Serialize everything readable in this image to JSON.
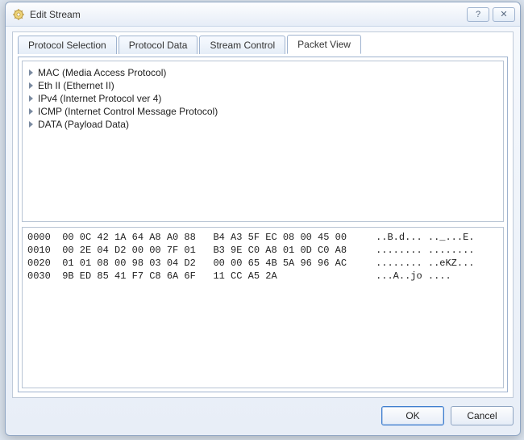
{
  "window": {
    "title": "Edit Stream",
    "icon": "gear-icon",
    "help_glyph": "?",
    "close_glyph": "✕"
  },
  "tabs": [
    {
      "label": "Protocol Selection",
      "active": false
    },
    {
      "label": "Protocol Data",
      "active": false
    },
    {
      "label": "Stream Control",
      "active": false
    },
    {
      "label": "Packet View",
      "active": true
    }
  ],
  "tree": [
    {
      "label": "MAC (Media Access Protocol)"
    },
    {
      "label": "Eth II (Ethernet II)"
    },
    {
      "label": "IPv4 (Internet Protocol ver 4)"
    },
    {
      "label": "ICMP (Internet Control Message Protocol)"
    },
    {
      "label": "DATA (Payload Data)"
    }
  ],
  "hex": {
    "rows": [
      {
        "offset": "0000",
        "bytes1": "00 0C 42 1A 64 A8 A0 88",
        "bytes2": "B4 A3 5F EC 08 00 45 00",
        "ascii": "..B.d... .._...E."
      },
      {
        "offset": "0010",
        "bytes1": "00 2E 04 D2 00 00 7F 01",
        "bytes2": "B3 9E C0 A8 01 0D C0 A8",
        "ascii": "........ ........"
      },
      {
        "offset": "0020",
        "bytes1": "01 01 08 00 98 03 04 D2",
        "bytes2": "00 00 65 4B 5A 96 96 AC",
        "ascii": "........ ..eKZ..."
      },
      {
        "offset": "0030",
        "bytes1": "9B ED 85 41 F7 C8 6A 6F",
        "bytes2": "11 CC A5 2A",
        "ascii": "...A..jo ...."
      }
    ]
  },
  "buttons": {
    "ok": "OK",
    "cancel": "Cancel"
  }
}
